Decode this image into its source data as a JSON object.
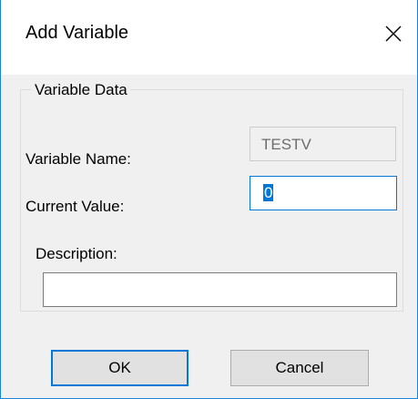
{
  "window": {
    "title": "Add Variable",
    "close_icon": "close-icon"
  },
  "group": {
    "legend": "Variable Data"
  },
  "fields": {
    "name_label": "Variable Name:",
    "name_value": "TESTV",
    "current_label": "Current Value:",
    "current_value": "0",
    "description_label": "Description:",
    "description_value": ""
  },
  "buttons": {
    "ok_label": "OK",
    "cancel_label": "Cancel"
  },
  "colors": {
    "accent": "#0078d7",
    "window_border": "#1883d7",
    "dialog_bg": "#f0f0f0"
  }
}
